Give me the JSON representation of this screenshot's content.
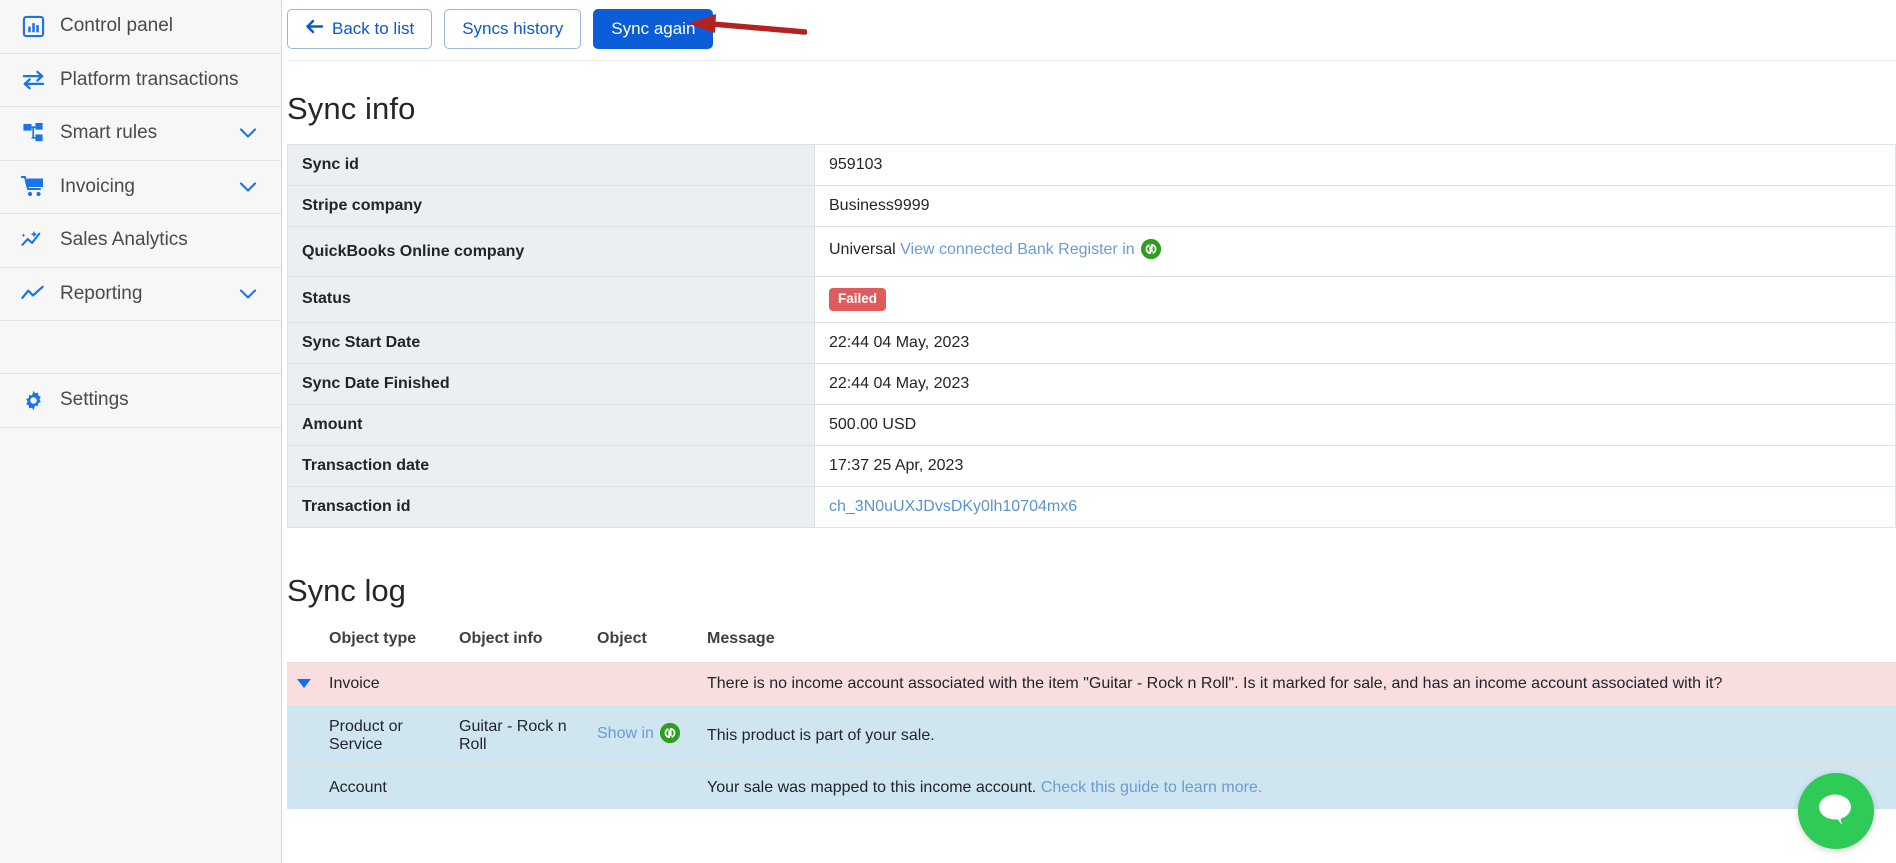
{
  "sidebar": {
    "items": [
      {
        "label": "Control panel",
        "icon": "dashboard-chart-icon",
        "expandable": false
      },
      {
        "label": "Platform transactions",
        "icon": "transfer-arrows-icon",
        "expandable": false
      },
      {
        "label": "Smart rules",
        "icon": "sitemap-nodes-icon",
        "expandable": true
      },
      {
        "label": "Invoicing",
        "icon": "shopping-cart-icon",
        "expandable": true
      },
      {
        "label": "Sales Analytics",
        "icon": "analytics-sparkle-icon",
        "expandable": false
      },
      {
        "label": "Reporting",
        "icon": "line-chart-icon",
        "expandable": true
      }
    ],
    "settings": {
      "label": "Settings",
      "icon": "gear-icon"
    }
  },
  "toolbar": {
    "back_label": "Back to list",
    "history_label": "Syncs history",
    "sync_again_label": "Sync again",
    "back_icon": "arrow-left-icon",
    "annotation": "red-arrow-pointing-to-sync-again"
  },
  "sync_info": {
    "title": "Sync info",
    "rows": [
      {
        "key": "Sync id",
        "value": "959103"
      },
      {
        "key": "Stripe company",
        "value": "Business9999"
      },
      {
        "key": "QuickBooks Online company",
        "value": "Universal",
        "link": "View connected Bank Register in",
        "icon": "quickbooks-icon"
      },
      {
        "key": "Status",
        "value": "Failed",
        "badge": true
      },
      {
        "key": "Sync Start Date",
        "value": "22:44 04 May, 2023"
      },
      {
        "key": "Sync Date Finished",
        "value": "22:44 04 May, 2023"
      },
      {
        "key": "Amount",
        "value": "500.00 USD"
      },
      {
        "key": "Transaction date",
        "value": "17:37 25 Apr, 2023"
      },
      {
        "key": "Transaction id",
        "value": "ch_3N0uUXJDvsDKy0lh10704mx6",
        "is_link": true
      }
    ]
  },
  "sync_log": {
    "title": "Sync log",
    "columns": [
      "Object type",
      "Object info",
      "Object",
      "Message"
    ],
    "rows": [
      {
        "object_type": "Invoice",
        "object_info": "",
        "object_link": "",
        "message": "There is no income account associated with the item \"Guitar - Rock n Roll\". Is it marked for sale, and has an income account associated with it?",
        "message_link": "",
        "variant": "error",
        "has_caret": true
      },
      {
        "object_type": "Product or Service",
        "object_info": "Guitar - Rock n Roll",
        "object_link": "Show in",
        "message": "This product is part of your sale.",
        "message_link": "",
        "variant": "info",
        "has_caret": false
      },
      {
        "object_type": "Account",
        "object_info": "",
        "object_link": "",
        "message": "Your sale was mapped to this income account.",
        "message_link": "Check this guide to learn more.",
        "variant": "info",
        "has_caret": false
      }
    ]
  },
  "chat": {
    "icon": "chat-bubble-icon",
    "color": "#2ecc57"
  },
  "colors": {
    "primary": "#0b5ed7",
    "link": "#6c9bd2",
    "danger": "#e05c5c",
    "quickbooks_green": "#2ca01c",
    "row_error_bg": "#f8dedf",
    "row_info_bg": "#cfe6f1",
    "key_cell_bg": "#eceff1",
    "annotation_red": "#b22222"
  }
}
